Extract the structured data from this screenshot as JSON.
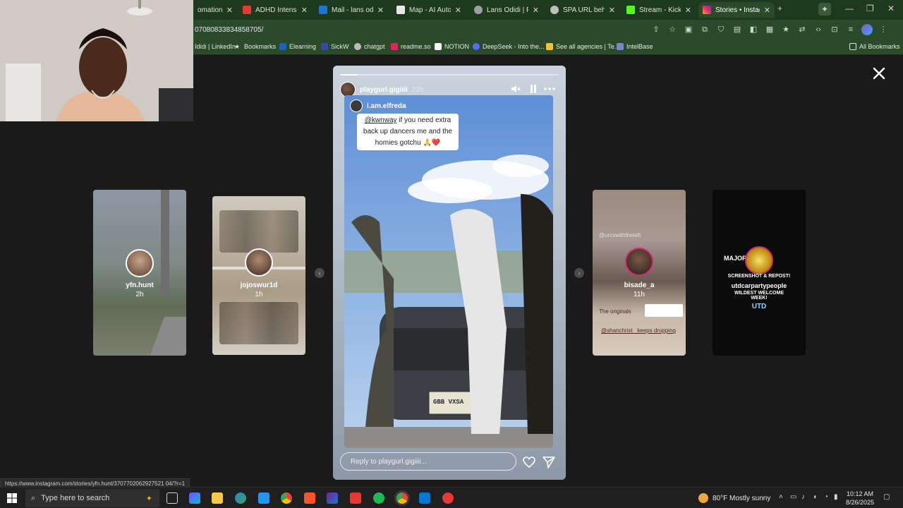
{
  "browser": {
    "tabs": [
      {
        "title": "omation A",
        "active": false,
        "icon": "generic-tab-icon",
        "color": "#4a6fa5"
      },
      {
        "title": "ADHD Intense R",
        "active": false,
        "icon": "youtube-icon",
        "color": "#e53935"
      },
      {
        "title": "Mail - lans odidi",
        "active": false,
        "icon": "outlook-icon",
        "color": "#1976d2"
      },
      {
        "title": "Map - AI Automa",
        "active": false,
        "icon": "sk-icon",
        "color": "#e8e8e8"
      },
      {
        "title": "Lans Odidi | Port",
        "active": false,
        "icon": "globe-icon",
        "color": "#9e9e9e"
      },
      {
        "title": "SPA URL behavio",
        "active": false,
        "icon": "chatgpt-icon",
        "color": "#bdbdbd"
      },
      {
        "title": "Stream - Kick Da",
        "active": false,
        "icon": "kick-icon",
        "color": "#53fc18"
      },
      {
        "title": "Stories • Instagra",
        "active": true,
        "icon": "instagram-icon",
        "color": "#e1306c"
      }
    ],
    "url": "07080833834858705/",
    "bookmarks": [
      {
        "label": "Ididi | LinkedIn",
        "color": "#0a66c2"
      },
      {
        "label": "Bookmarks",
        "color": "#e0e0e0"
      },
      {
        "label": "Elearning",
        "color": "#1565c0"
      },
      {
        "label": "SickW",
        "color": "#3949ab"
      },
      {
        "label": "chatgpt",
        "color": "#bdbdbd"
      },
      {
        "label": "readme.so",
        "color": "#e91e63"
      },
      {
        "label": "NOTION",
        "color": "#f5f5f5"
      },
      {
        "label": "DeepSeek - Into the...",
        "color": "#4d6bfe"
      },
      {
        "label": "See all agencies | Te...",
        "color": "#fbc02d"
      },
      {
        "label": "IntelBase",
        "color": "#7986cb"
      }
    ],
    "all_bookmarks": "All Bookmarks",
    "status_url": "https://www.instagram.com/stories/yfn.hunt/3707702062927521 04/?r=1"
  },
  "stories": {
    "left": [
      {
        "username": "yfn.hunt",
        "time": "2h"
      },
      {
        "username": "jojoswur1d",
        "time": "1h"
      }
    ],
    "right": [
      {
        "username": "bisade_a",
        "time": "11h",
        "overlay_top": "@urcvwiththeleft",
        "overlay_mid": "The originals",
        "overlay_bottom": "@shanchrist_ keeps dropping"
      },
      {
        "username": "utdcarpartypeople",
        "time": "",
        "line1": "MAJOR ALERT!",
        "line2": "SCREENSHOT & REPOST!",
        "line3": "WILDEST WELCOME WEEK!",
        "line4": "UTD"
      }
    ],
    "main": {
      "username": "playgurl.gigiiii",
      "time": "22h",
      "progress": 0.08,
      "reposted_from": "i.am.elfreda",
      "caption_mention": "@kwnway",
      "caption_text": " if you need extra back up dancers me and the homies gotchu 🙏❤️",
      "reply_placeholder": "Reply to playgurl.gigiiii...",
      "plate": "GBB VXSA"
    }
  },
  "taskbar": {
    "search_placeholder": "Type here to search",
    "weather_temp": "80°F",
    "weather_desc": "Mostly sunny",
    "time": "10:12 AM",
    "date": "8/26/2025"
  }
}
